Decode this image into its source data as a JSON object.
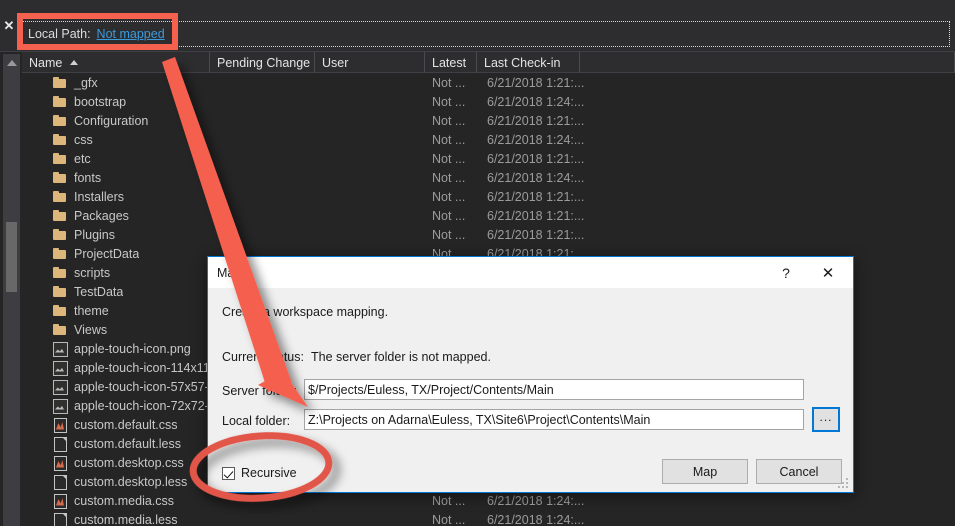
{
  "toolbar": {
    "close_icon": "close-icon",
    "local_path_label": "Local Path:",
    "local_path_value": "Not mapped"
  },
  "grid": {
    "columns": [
      {
        "key": "name",
        "label": "Name",
        "sort": "ascending"
      },
      {
        "key": "pending",
        "label": "Pending Change",
        "sort": ""
      },
      {
        "key": "user",
        "label": "User",
        "sort": ""
      },
      {
        "key": "latest",
        "label": "Latest",
        "sort": ""
      },
      {
        "key": "checkin",
        "label": "Last Check-in",
        "sort": ""
      }
    ],
    "rows": [
      {
        "icon": "folder-icon",
        "name": "_gfx",
        "pending": "",
        "user": "",
        "latest": "Not ...",
        "checkin": "6/21/2018 1:21:..."
      },
      {
        "icon": "folder-icon",
        "name": "bootstrap",
        "pending": "",
        "user": "",
        "latest": "Not ...",
        "checkin": "6/21/2018 1:24:..."
      },
      {
        "icon": "folder-icon",
        "name": "Configuration",
        "pending": "",
        "user": "",
        "latest": "Not ...",
        "checkin": "6/21/2018 1:21:..."
      },
      {
        "icon": "folder-icon",
        "name": "css",
        "pending": "",
        "user": "",
        "latest": "Not ...",
        "checkin": "6/21/2018 1:24:..."
      },
      {
        "icon": "folder-icon",
        "name": "etc",
        "pending": "",
        "user": "",
        "latest": "Not ...",
        "checkin": "6/21/2018 1:21:..."
      },
      {
        "icon": "folder-icon",
        "name": "fonts",
        "pending": "",
        "user": "",
        "latest": "Not ...",
        "checkin": "6/21/2018 1:24:..."
      },
      {
        "icon": "folder-icon",
        "name": "Installers",
        "pending": "",
        "user": "",
        "latest": "Not ...",
        "checkin": "6/21/2018 1:21:..."
      },
      {
        "icon": "folder-icon",
        "name": "Packages",
        "pending": "",
        "user": "",
        "latest": "Not ...",
        "checkin": "6/21/2018 1:21:..."
      },
      {
        "icon": "folder-icon",
        "name": "Plugins",
        "pending": "",
        "user": "",
        "latest": "Not ...",
        "checkin": "6/21/2018 1:21:..."
      },
      {
        "icon": "folder-icon",
        "name": "ProjectData",
        "pending": "",
        "user": "",
        "latest": "Not ...",
        "checkin": "6/21/2018 1:21:..."
      },
      {
        "icon": "folder-icon",
        "name": "scripts",
        "pending": "",
        "user": "",
        "latest": "",
        "checkin": ""
      },
      {
        "icon": "folder-icon",
        "name": "TestData",
        "pending": "",
        "user": "",
        "latest": "",
        "checkin": ""
      },
      {
        "icon": "folder-icon",
        "name": "theme",
        "pending": "",
        "user": "",
        "latest": "",
        "checkin": ""
      },
      {
        "icon": "folder-icon",
        "name": "Views",
        "pending": "",
        "user": "",
        "latest": "",
        "checkin": ""
      },
      {
        "icon": "image-icon",
        "name": "apple-touch-icon.png",
        "pending": "",
        "user": "",
        "latest": "",
        "checkin": ""
      },
      {
        "icon": "image-icon",
        "name": "apple-touch-icon-114x11",
        "pending": "",
        "user": "",
        "latest": "",
        "checkin": ""
      },
      {
        "icon": "image-icon",
        "name": "apple-touch-icon-57x57-",
        "pending": "",
        "user": "",
        "latest": "",
        "checkin": ""
      },
      {
        "icon": "image-icon",
        "name": "apple-touch-icon-72x72-",
        "pending": "",
        "user": "",
        "latest": "",
        "checkin": ""
      },
      {
        "icon": "css-icon",
        "name": "custom.default.css",
        "pending": "",
        "user": "",
        "latest": "",
        "checkin": ""
      },
      {
        "icon": "doc-icon",
        "name": "custom.default.less",
        "pending": "",
        "user": "",
        "latest": "",
        "checkin": ""
      },
      {
        "icon": "css-icon",
        "name": "custom.desktop.css",
        "pending": "",
        "user": "",
        "latest": "",
        "checkin": ""
      },
      {
        "icon": "doc-icon",
        "name": "custom.desktop.less",
        "pending": "",
        "user": "",
        "latest": "",
        "checkin": ""
      },
      {
        "icon": "css-icon",
        "name": "custom.media.css",
        "pending": "",
        "user": "",
        "latest": "Not ...",
        "checkin": "6/21/2018 1:24:..."
      },
      {
        "icon": "doc-icon",
        "name": "custom.media.less",
        "pending": "",
        "user": "",
        "latest": "Not ...",
        "checkin": "6/21/2018 1:24:..."
      }
    ]
  },
  "dialog": {
    "title": "Map",
    "help_icon": "?",
    "close_icon": "✕",
    "subtitle": "Create a workspace mapping.",
    "status_label": "Current status:",
    "status_value": "The server folder is not mapped.",
    "server_label": "Server folder:",
    "server_value": "$/Projects/Euless, TX/Project/Contents/Main",
    "local_label": "Local folder:",
    "local_value": "Z:\\Projects on Adarna\\Euless, TX\\Site6\\Project\\Contents\\Main",
    "browse_label": "...",
    "recursive_label": "Recursive",
    "recursive_checked": true,
    "map_button": "Map",
    "cancel_button": "Cancel"
  },
  "annotations": {
    "color": "#f4614e",
    "rect_target": "Local Path: Not mapped",
    "arrow_from": "local-path-link",
    "arrow_to": "local-folder-field",
    "ellipse_target": "recursive-checkbox"
  },
  "colors": {
    "background": "#252526",
    "panel": "#2d2d30",
    "link": "#3a9bdc",
    "dialog_border": "#0078d7",
    "annotation": "#f4614e",
    "folder": "#dcb67a"
  }
}
